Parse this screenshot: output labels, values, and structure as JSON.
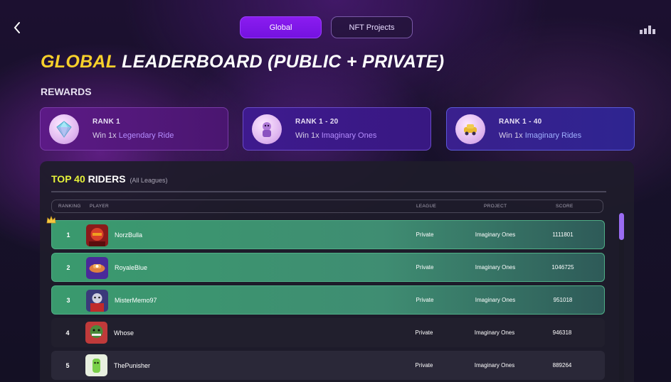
{
  "nav": {
    "back_icon": "chevron-left-icon",
    "stats_icon": "bars-icon",
    "tabs": [
      {
        "label": "Global",
        "active": true
      },
      {
        "label": "NFT Projects",
        "active": false
      }
    ]
  },
  "header": {
    "title_highlight": "GLOBAL",
    "title_rest": "LEADERBOARD (PUBLIC + PRIVATE)"
  },
  "rewards": {
    "label": "REWARDS",
    "items": [
      {
        "rank": "RANK 1",
        "win_prefix": "Win 1x",
        "prize": "Legendary Ride",
        "icon": "diamond-icon"
      },
      {
        "rank": "RANK 1 - 20",
        "win_prefix": "Win 1x",
        "prize": "Imaginary Ones",
        "icon": "character-icon"
      },
      {
        "rank": "RANK 1 - 40",
        "win_prefix": "Win 1x",
        "prize": "Imaginary Rides",
        "icon": "car-icon"
      }
    ]
  },
  "leaderboard": {
    "title_highlight": "TOP 40",
    "title_rest": "RIDERS",
    "subtitle": "(All Leagues)",
    "columns": {
      "ranking": "RANKING",
      "player": "PLAYER",
      "league": "LEAGUE",
      "project": "PROJECT",
      "score": "SCORE"
    },
    "rows": [
      {
        "rank": "1",
        "player": "NorzBulla",
        "league": "Private",
        "project": "Imaginary Ones",
        "score": "1111801"
      },
      {
        "rank": "2",
        "player": "RoyaleBlue",
        "league": "Private",
        "project": "Imaginary Ones",
        "score": "1046725"
      },
      {
        "rank": "3",
        "player": "MisterMemo97",
        "league": "Private",
        "project": "Imaginary Ones",
        "score": "951018"
      },
      {
        "rank": "4",
        "player": "Whose",
        "league": "Private",
        "project": "Imaginary Ones",
        "score": "946318"
      },
      {
        "rank": "5",
        "player": "ThePunisher",
        "league": "Private",
        "project": "Imaginary Ones",
        "score": "889264"
      }
    ]
  },
  "colors": {
    "accent_purple": "#8b1cf0",
    "title_yellow": "#f7d02b",
    "top_row_green": "#3f8d72"
  }
}
